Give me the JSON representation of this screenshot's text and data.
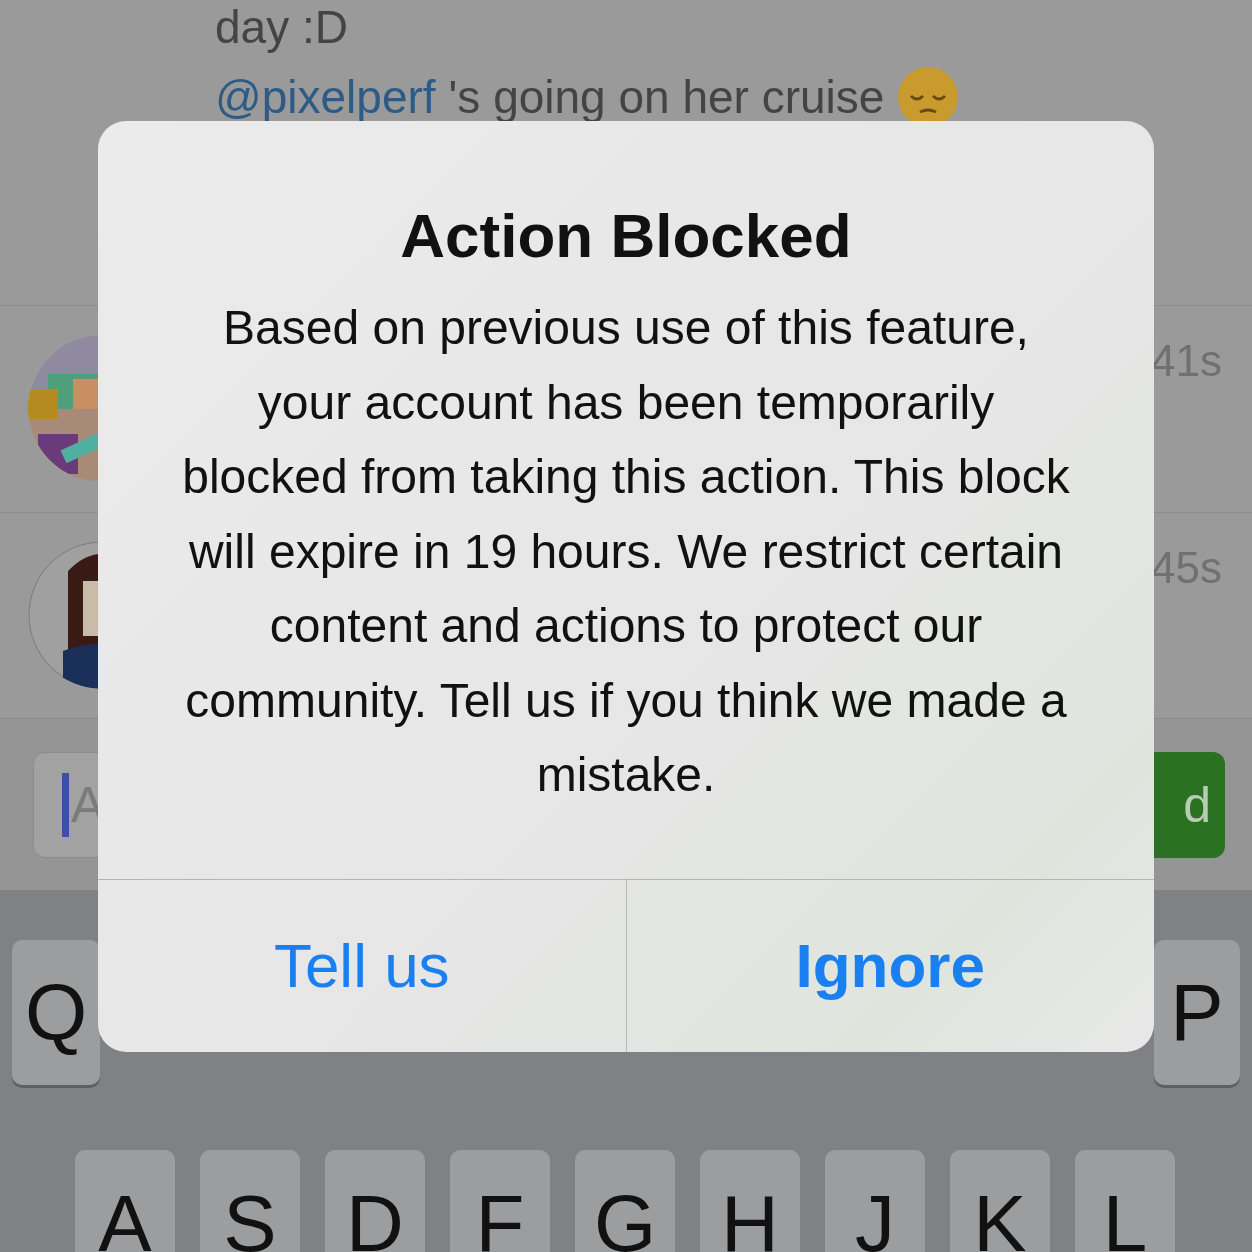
{
  "feed": {
    "comments": [
      {
        "text": "day :D"
      },
      {
        "mention": "@pixelperf",
        "text": "'s going on her cruise",
        "emoji": true
      }
    ],
    "rows": [
      {
        "time": "41s"
      },
      {
        "time": "45s"
      }
    ]
  },
  "composer": {
    "placeholder": "A",
    "button": "d"
  },
  "keyboard": {
    "rows": [
      [
        "Q",
        "P"
      ],
      [
        "A",
        "S",
        "D",
        "F",
        "G",
        "H",
        "J",
        "K",
        "L"
      ]
    ]
  },
  "dialog": {
    "title": "Action Blocked",
    "message": "Based on previous use of this feature, your account has been temporarily blocked from taking this action. This block will expire in 19 hours. We restrict certain content and actions to protect our community. Tell us if you think we made a mistake.",
    "buttons": [
      {
        "label": "Tell us",
        "preferred": false
      },
      {
        "label": "Ignore",
        "preferred": true
      }
    ]
  }
}
